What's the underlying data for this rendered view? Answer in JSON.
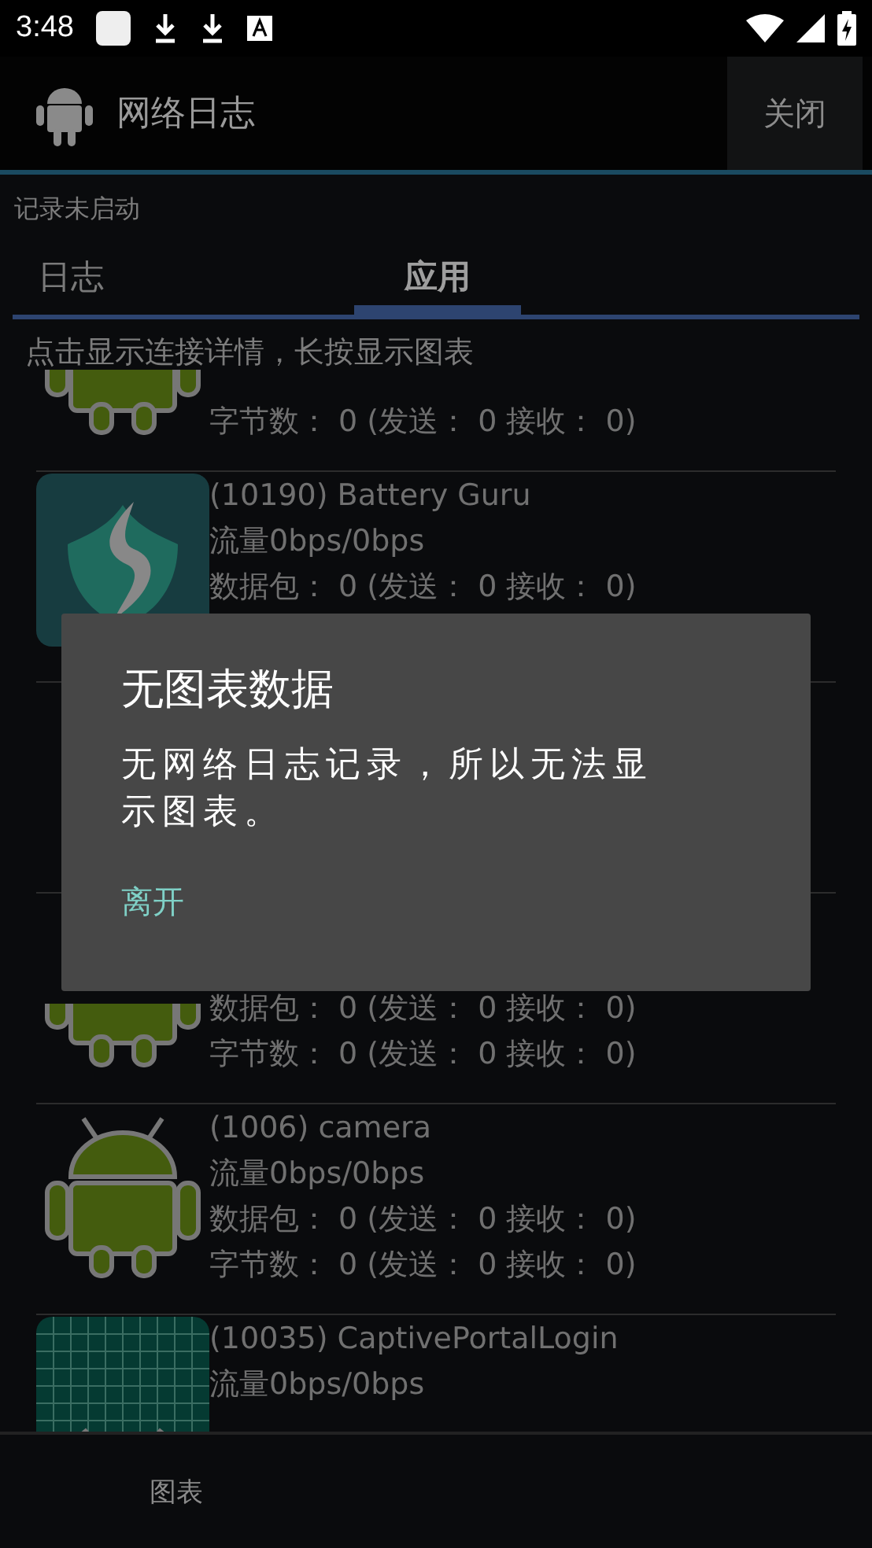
{
  "status_bar": {
    "time": "3:48"
  },
  "app_bar": {
    "title": "网络日志",
    "close_button": "关闭"
  },
  "recording_status": "记录未启动",
  "tabs": [
    {
      "label": "日志",
      "selected": false
    },
    {
      "label": "应用",
      "selected": true
    }
  ],
  "hint": "点击显示连接详情，长按显示图表",
  "apps": [
    {
      "kind": "android",
      "lines": [
        {
          "kind": "bytes",
          "text": "字节数： 0 (发送： 0 接收： 0)"
        }
      ]
    },
    {
      "kind": "shield-leaf",
      "lines": [
        {
          "kind": "title",
          "text": "(10190) Battery Guru"
        },
        {
          "kind": "rate",
          "text": "流量0bps/0bps"
        },
        {
          "kind": "packets",
          "text": "数据包： 0 (发送： 0 接收： 0)"
        }
      ]
    },
    {
      "kind": "covered"
    },
    {
      "kind": "android-bottom",
      "lines": [
        {
          "kind": "packets",
          "text": "数据包： 0 (发送： 0 接收： 0)"
        },
        {
          "kind": "bytes",
          "text": "字节数： 0 (发送： 0 接收： 0)"
        }
      ]
    },
    {
      "kind": "android",
      "lines": [
        {
          "kind": "title",
          "text": "(1006) camera"
        },
        {
          "kind": "rate",
          "text": "流量0bps/0bps"
        },
        {
          "kind": "packets",
          "text": "数据包： 0 (发送： 0 接收： 0)"
        },
        {
          "kind": "bytes",
          "text": "字节数： 0 (发送： 0 接收： 0)"
        }
      ]
    },
    {
      "kind": "grid-android",
      "lines": [
        {
          "kind": "title",
          "text": "(10035) CaptivePortalLogin"
        },
        {
          "kind": "rate",
          "text": "流量0bps/0bps"
        }
      ]
    }
  ],
  "bottom_bar": {
    "chart_button": "图表"
  },
  "dialog": {
    "title": "无图表数据",
    "message": "无网络日志记录，所以无法显示图表。",
    "button": "离开"
  }
}
